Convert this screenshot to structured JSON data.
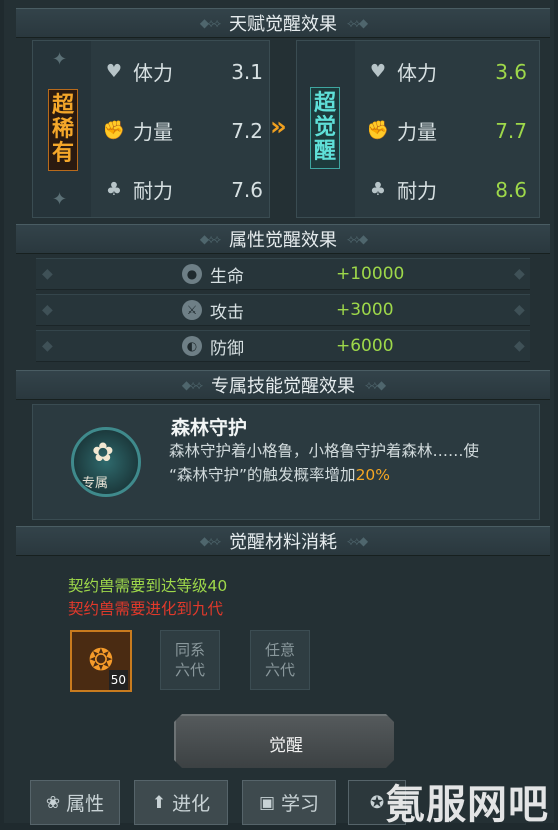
{
  "talent": {
    "title": "天赋觉醒效果",
    "left_badge": "超稀有",
    "right_badge": "超觉醒",
    "stats_before": [
      {
        "label": "体力",
        "value": "3.1",
        "icon": "heart-icon"
      },
      {
        "label": "力量",
        "value": "7.2",
        "icon": "fist-icon"
      },
      {
        "label": "耐力",
        "value": "7.6",
        "icon": "clover-icon"
      }
    ],
    "stats_after": [
      {
        "label": "体力",
        "value": "3.6",
        "icon": "heart-icon"
      },
      {
        "label": "力量",
        "value": "7.7",
        "icon": "fist-icon"
      },
      {
        "label": "耐力",
        "value": "8.6",
        "icon": "clover-icon"
      }
    ]
  },
  "attribute": {
    "title": "属性觉醒效果",
    "rows": [
      {
        "label": "生命",
        "value": "+10000",
        "icon": "life-icon"
      },
      {
        "label": "攻击",
        "value": "+3000",
        "icon": "attack-icon"
      },
      {
        "label": "防御",
        "value": "+6000",
        "icon": "defense-icon"
      }
    ]
  },
  "skill": {
    "title": "专属技能觉醒效果",
    "name": "森林守护",
    "badge": "专属",
    "desc_line1": "森林守护着小格鲁，小格鲁守护着森林……使",
    "desc_line2_prefix": "“森林守护”的触发概率增加",
    "desc_highlight": "20%"
  },
  "materials": {
    "title": "觉醒材料消耗",
    "req_level": "契约兽需要到达等级40",
    "req_evolve": "契约兽需要进化到九代",
    "item_count": "50",
    "slot2_line1": "同系",
    "slot2_line2": "六代",
    "slot3_line1": "任意",
    "slot3_line2": "六代"
  },
  "awaken_button": "觉醒",
  "tabs": [
    {
      "label": "属性",
      "icon": "paw-icon"
    },
    {
      "label": "进化",
      "icon": "arrow-up-icon"
    },
    {
      "label": "学习",
      "icon": "book-icon"
    }
  ],
  "watermark": "氪服网吧",
  "colors": {
    "green": "#9ed84a",
    "red": "#e0392b",
    "orange": "#f5a623"
  }
}
